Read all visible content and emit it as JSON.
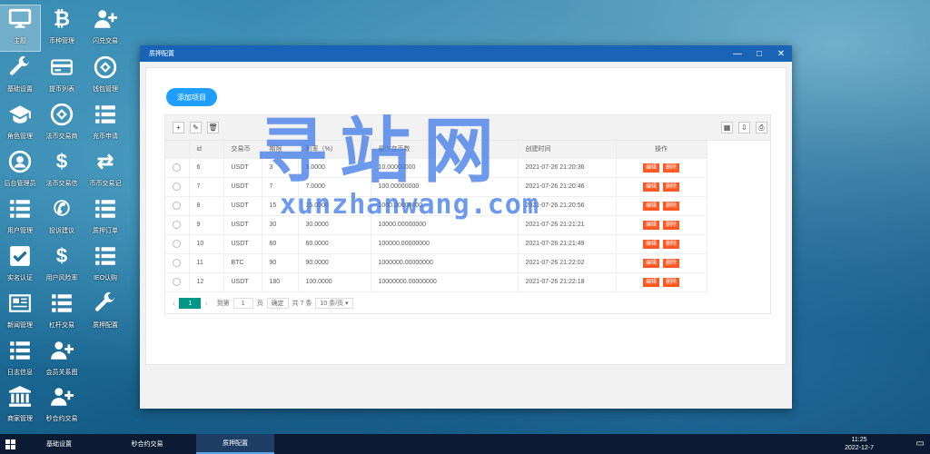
{
  "desktop": {
    "icons": [
      {
        "label": "主题",
        "icon": "monitor-icon"
      },
      {
        "label": "币种管理",
        "icon": "bitcoin-icon"
      },
      {
        "label": "闪兑交易",
        "icon": "user-plus-icon"
      },
      {
        "label": "基础设置",
        "icon": "wrench-icon"
      },
      {
        "label": "提币列表",
        "icon": "credit-card-icon"
      },
      {
        "label": "钱包管理",
        "icon": "link-icon"
      },
      {
        "label": "角色管理",
        "icon": "graduation-cap-icon"
      },
      {
        "label": "法币交易商",
        "icon": "link-icon"
      },
      {
        "label": "充币申请",
        "icon": "list-icon"
      },
      {
        "label": "后台管理员",
        "icon": "user-circle-icon"
      },
      {
        "label": "法币交易信",
        "icon": "dollar-icon"
      },
      {
        "label": "币币交易记",
        "icon": "exchange-icon"
      },
      {
        "label": "用户管理",
        "icon": "list-icon"
      },
      {
        "label": "投诉建议",
        "icon": "phone-icon"
      },
      {
        "label": "质押订单",
        "icon": "list-icon"
      },
      {
        "label": "实名认证",
        "icon": "check-square-icon"
      },
      {
        "label": "用户风险率",
        "icon": "dollar-icon"
      },
      {
        "label": "IEO认购",
        "icon": "list-icon"
      },
      {
        "label": "新闻管理",
        "icon": "newspaper-icon"
      },
      {
        "label": "杠杆交易",
        "icon": "list-icon"
      },
      {
        "label": "质押配置",
        "icon": "wrench-icon"
      },
      {
        "label": "日志信息",
        "icon": "list-icon"
      },
      {
        "label": "会员关系图",
        "icon": "user-plus-icon"
      },
      {
        "label": "商家管理",
        "icon": "bank-icon"
      },
      {
        "label": "秒合约交易",
        "icon": "user-plus-icon"
      }
    ]
  },
  "window": {
    "title": "质押配置",
    "controls": {
      "minimize": "—",
      "maximize": "□",
      "close": "✕"
    },
    "add_button": "添加项目",
    "toolbar": {
      "add": "+",
      "edit": "✎",
      "delete": "🗑",
      "columns": "▦",
      "export": "⇩",
      "print": "⎙"
    },
    "columns": [
      "id",
      "交易币",
      "期限",
      "利率（%）",
      "最少存币数",
      "创建时间",
      "操作"
    ],
    "rows": [
      {
        "id": "6",
        "coin": "USDT",
        "term": "3",
        "rate": "3.0000",
        "min": "10.00000000",
        "created": "2021-07-26 21:20:36"
      },
      {
        "id": "7",
        "coin": "USDT",
        "term": "7",
        "rate": "7.0000",
        "min": "100.00000000",
        "created": "2021-07-26 21:20:46"
      },
      {
        "id": "8",
        "coin": "USDT",
        "term": "15",
        "rate": "15.0000",
        "min": "1000.00000000",
        "created": "2021-07-26 21:20:56"
      },
      {
        "id": "9",
        "coin": "USDT",
        "term": "30",
        "rate": "30.0000",
        "min": "10000.00000000",
        "created": "2021-07-26 21:21:21"
      },
      {
        "id": "10",
        "coin": "USDT",
        "term": "60",
        "rate": "60.0000",
        "min": "100000.00000000",
        "created": "2021-07-26 21:21:49"
      },
      {
        "id": "11",
        "coin": "BTC",
        "term": "90",
        "rate": "90.0000",
        "min": "1000000.00000000",
        "created": "2021-07-26 21:22:02"
      },
      {
        "id": "12",
        "coin": "USDT",
        "term": "180",
        "rate": "100.0000",
        "min": "10000000.00000000",
        "created": "2021-07-26 21:22:18"
      }
    ],
    "row_actions": {
      "edit": "编辑",
      "delete": "删除"
    },
    "pager": {
      "prev": "‹",
      "current": "1",
      "next": "›",
      "goto_label": "到第",
      "goto_value": "1",
      "page_unit": "页",
      "confirm": "确定",
      "total": "共 7 条",
      "per_page": "10 条/页"
    }
  },
  "watermark": {
    "cn": "寻站网",
    "en": "xunzhanwang.com"
  },
  "taskbar": {
    "tasks": [
      "基础设置",
      "秒合约交易",
      "质押配置"
    ],
    "active_task": "质押配置",
    "time": "11:25",
    "date": "2022-12-7"
  },
  "colors": {
    "titlebar": "#1a64b7",
    "primary": "#1e9fff",
    "danger": "#ff5722",
    "pager_current": "#009688",
    "taskbar": "#0b1b33"
  }
}
